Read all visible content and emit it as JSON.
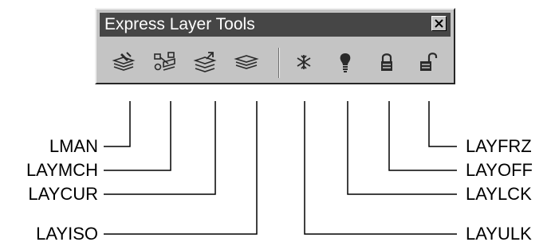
{
  "toolbar": {
    "title": "Express Layer Tools",
    "close_glyph": "✕",
    "buttons": [
      {
        "command": "LMAN",
        "icon": "layer-manager-icon"
      },
      {
        "command": "LAYMCH",
        "icon": "layer-match-icon"
      },
      {
        "command": "LAYCUR",
        "icon": "change-to-current-layer-icon"
      },
      {
        "command": "LAYISO",
        "icon": "layer-isolate-icon"
      },
      {
        "command": "LAYULK",
        "icon": "snowflake-icon"
      },
      {
        "command": "LAYLCK",
        "icon": "lightbulb-icon"
      },
      {
        "command": "LAYOFF",
        "icon": "lock-icon"
      },
      {
        "command": "LAYFRZ",
        "icon": "unlock-icon"
      }
    ]
  },
  "callouts": {
    "lman": "LMAN",
    "laymch": "LAYMCH",
    "laycur": "LAYCUR",
    "layiso": "LAYISO",
    "layfrz": "LAYFRZ",
    "layoff": "LAYOFF",
    "laylck": "LAYLCK",
    "layulk": "LAYULK"
  },
  "colors": {
    "toolbar_face": "#c4c4c4",
    "titlebar": "#464646",
    "icon_dark": "#2a2a2a",
    "leader_line": "#000000"
  }
}
